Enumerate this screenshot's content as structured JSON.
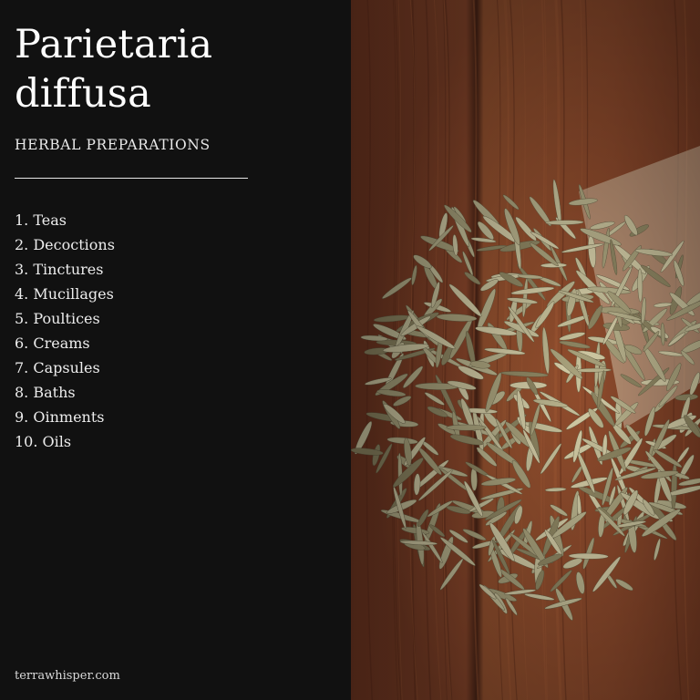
{
  "title_lines": [
    "Parietaria",
    "diffusa"
  ],
  "subtitle": "HERBAL PREPARATIONS",
  "preparations": [
    "1. Teas",
    "2. Decoctions",
    "3. Tinctures",
    "4. Mucillages",
    "5. Poultices",
    "6. Creams",
    "7. Capsules",
    "8. Baths",
    "9. Oinments",
    "10. Oils"
  ],
  "footer": "terrawhisper.com",
  "colors": {
    "panel_bg": "#111111",
    "text": "#f1f1f1",
    "wood": "#8c4a2d",
    "herb": "#b7b08a"
  },
  "photo": {
    "subject": "dried herb leaves heaped on a wooden table"
  }
}
